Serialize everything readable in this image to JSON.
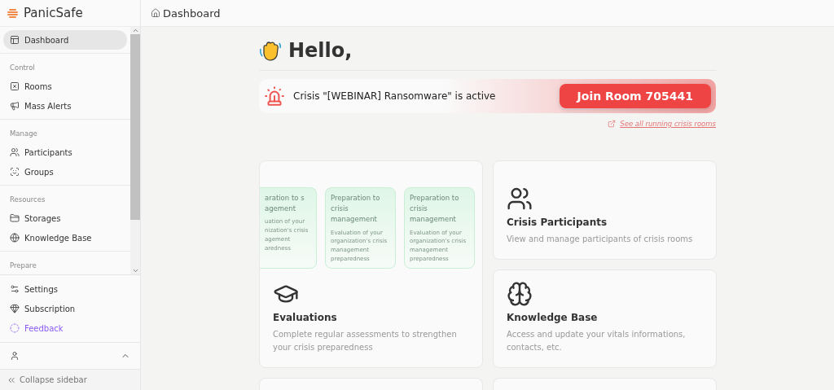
{
  "app": {
    "name": "PanicSafe"
  },
  "sidebar": {
    "top_items": [
      {
        "label": "Dashboard",
        "selected": true
      }
    ],
    "sections": [
      {
        "title": "Control",
        "items": [
          {
            "label": "Rooms",
            "selected": false
          },
          {
            "label": "Mass Alerts",
            "selected": false
          }
        ]
      },
      {
        "title": "Manage",
        "items": [
          {
            "label": "Participants",
            "selected": false
          },
          {
            "label": "Groups",
            "selected": false
          }
        ]
      },
      {
        "title": "Resources",
        "items": [
          {
            "label": "Storages",
            "selected": false
          },
          {
            "label": "Knowledge Base",
            "selected": false
          }
        ]
      },
      {
        "title": "Prepare"
      }
    ],
    "bottom_items": [
      {
        "label": "Settings",
        "kind": "normal"
      },
      {
        "label": "Subscription",
        "kind": "normal"
      },
      {
        "label": "Feedback",
        "kind": "accent"
      }
    ],
    "collapse": "Collapse sidebar"
  },
  "breadcrumb": "Dashboard",
  "greeting": "Hello,",
  "alert": {
    "message": "Crisis \"[WEBINAR] Ransomware\" is active",
    "button": "Join Room 705441",
    "link": "See all running crisis rooms"
  },
  "cards": [
    {
      "kind": "evaluations",
      "title": "Evaluations",
      "description": "Complete regular assessments to strengthen your crisis preparedness",
      "previews": [
        {
          "clipped": true,
          "title": "aration to s agement",
          "description": "uation of your nization's crisis agement aredness"
        },
        {
          "clipped": false,
          "title": "Preparation to crisis management",
          "description": "Evaluation of your organization's crisis management preparedness"
        },
        {
          "clipped": false,
          "title": "Preparation to crisis management",
          "description": "Evaluation of your organization's crisis management preparedness"
        }
      ]
    },
    {
      "kind": "participants",
      "title": "Crisis Participants",
      "description": "View and manage participants of crisis rooms"
    },
    {
      "kind": "knowledge",
      "title": "Knowledge Base",
      "description": "Access and update your vitals informations, contacts, etc."
    }
  ]
}
